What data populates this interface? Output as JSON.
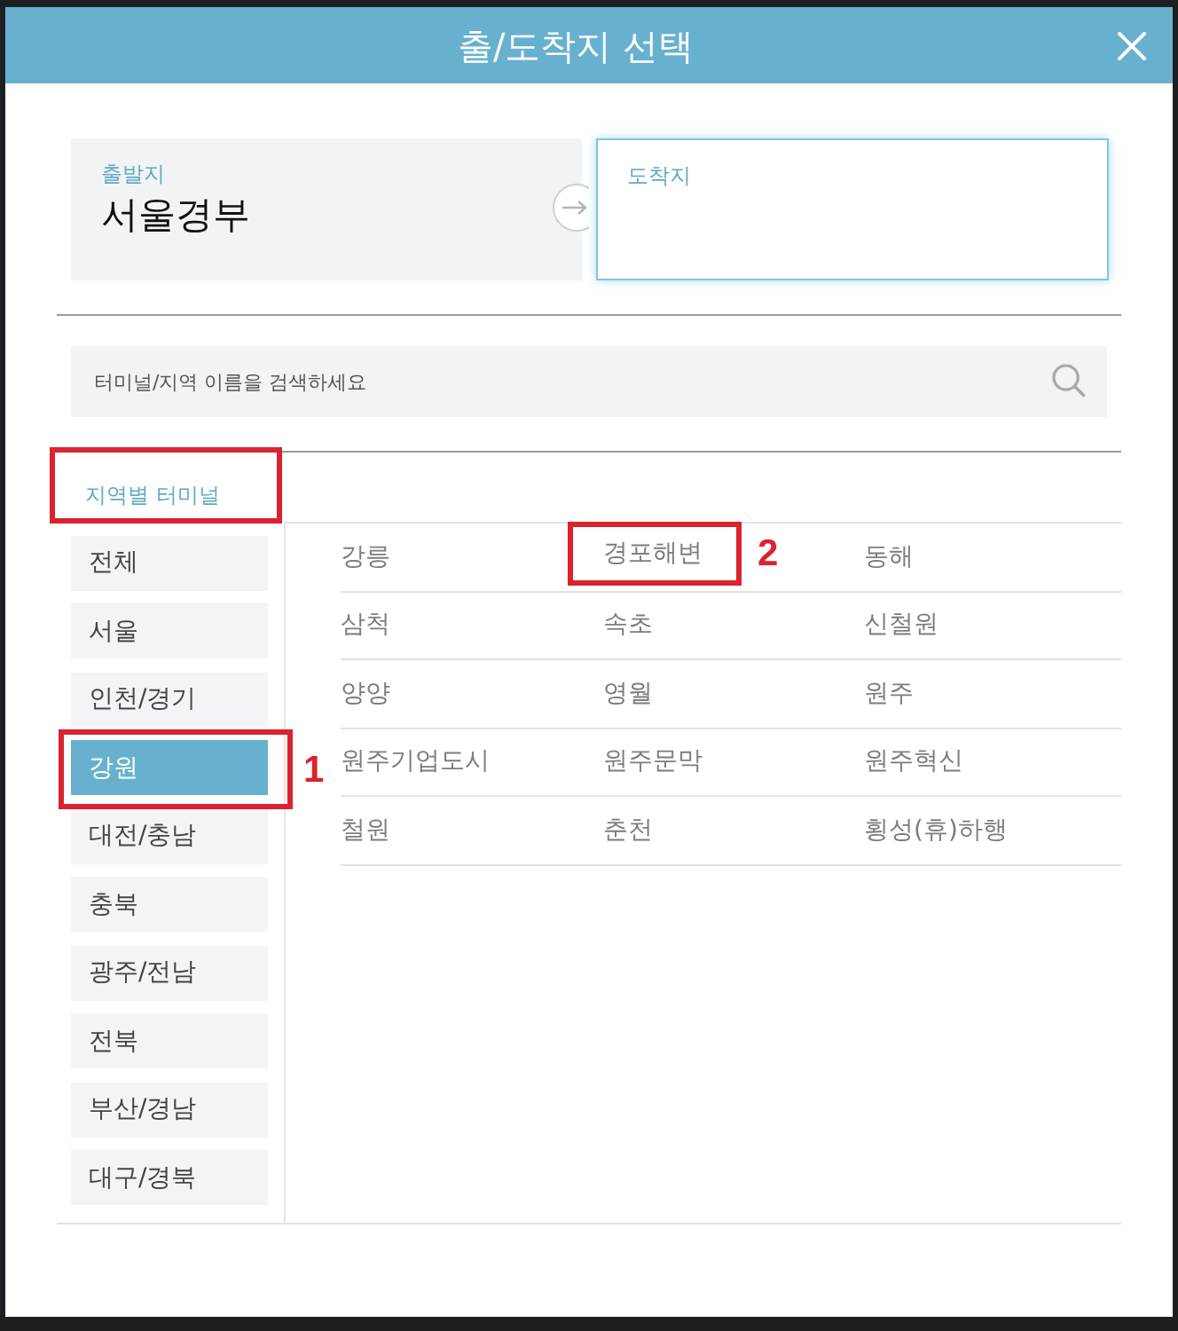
{
  "dialog": {
    "title": "출/도착지 선택"
  },
  "route": {
    "departure": {
      "label": "출발지",
      "value": "서울경부",
      "focused": false
    },
    "arrival": {
      "label": "도착지",
      "focused": true
    }
  },
  "search": {
    "placeholder": "터미널/지역 이름을 검색하세요"
  },
  "region_tab": {
    "label": "지역별 터미널",
    "highlighted": true
  },
  "regions": [
    {
      "label": "전체",
      "selected": false,
      "highlighted": false
    },
    {
      "label": "서울",
      "selected": false,
      "highlighted": false
    },
    {
      "label": "인천/경기",
      "selected": false,
      "highlighted": false
    },
    {
      "label": "강원",
      "selected": true,
      "highlighted": true,
      "marker": "1"
    },
    {
      "label": "대전/충남",
      "selected": false,
      "highlighted": false
    },
    {
      "label": "충북",
      "selected": false,
      "highlighted": false
    },
    {
      "label": "광주/전남",
      "selected": false,
      "highlighted": false
    },
    {
      "label": "전북",
      "selected": false,
      "highlighted": false
    },
    {
      "label": "부산/경남",
      "selected": false,
      "highlighted": false
    },
    {
      "label": "대구/경북",
      "selected": false,
      "highlighted": false
    }
  ],
  "terminals": [
    {
      "label": "강릉",
      "highlighted": false
    },
    {
      "label": "경포해변",
      "highlighted": true,
      "marker": "2"
    },
    {
      "label": "동해",
      "highlighted": false
    },
    {
      "label": "삼척",
      "highlighted": false
    },
    {
      "label": "속초",
      "highlighted": false
    },
    {
      "label": "신철원",
      "highlighted": false
    },
    {
      "label": "양양",
      "highlighted": false
    },
    {
      "label": "영월",
      "highlighted": false
    },
    {
      "label": "원주",
      "highlighted": false
    },
    {
      "label": "원주기업도시",
      "highlighted": false
    },
    {
      "label": "원주문막",
      "highlighted": false
    },
    {
      "label": "원주혁신",
      "highlighted": false
    },
    {
      "label": "철원",
      "highlighted": false
    },
    {
      "label": "춘천",
      "highlighted": false
    },
    {
      "label": "횡성(휴)하행",
      "highlighted": false
    }
  ]
}
